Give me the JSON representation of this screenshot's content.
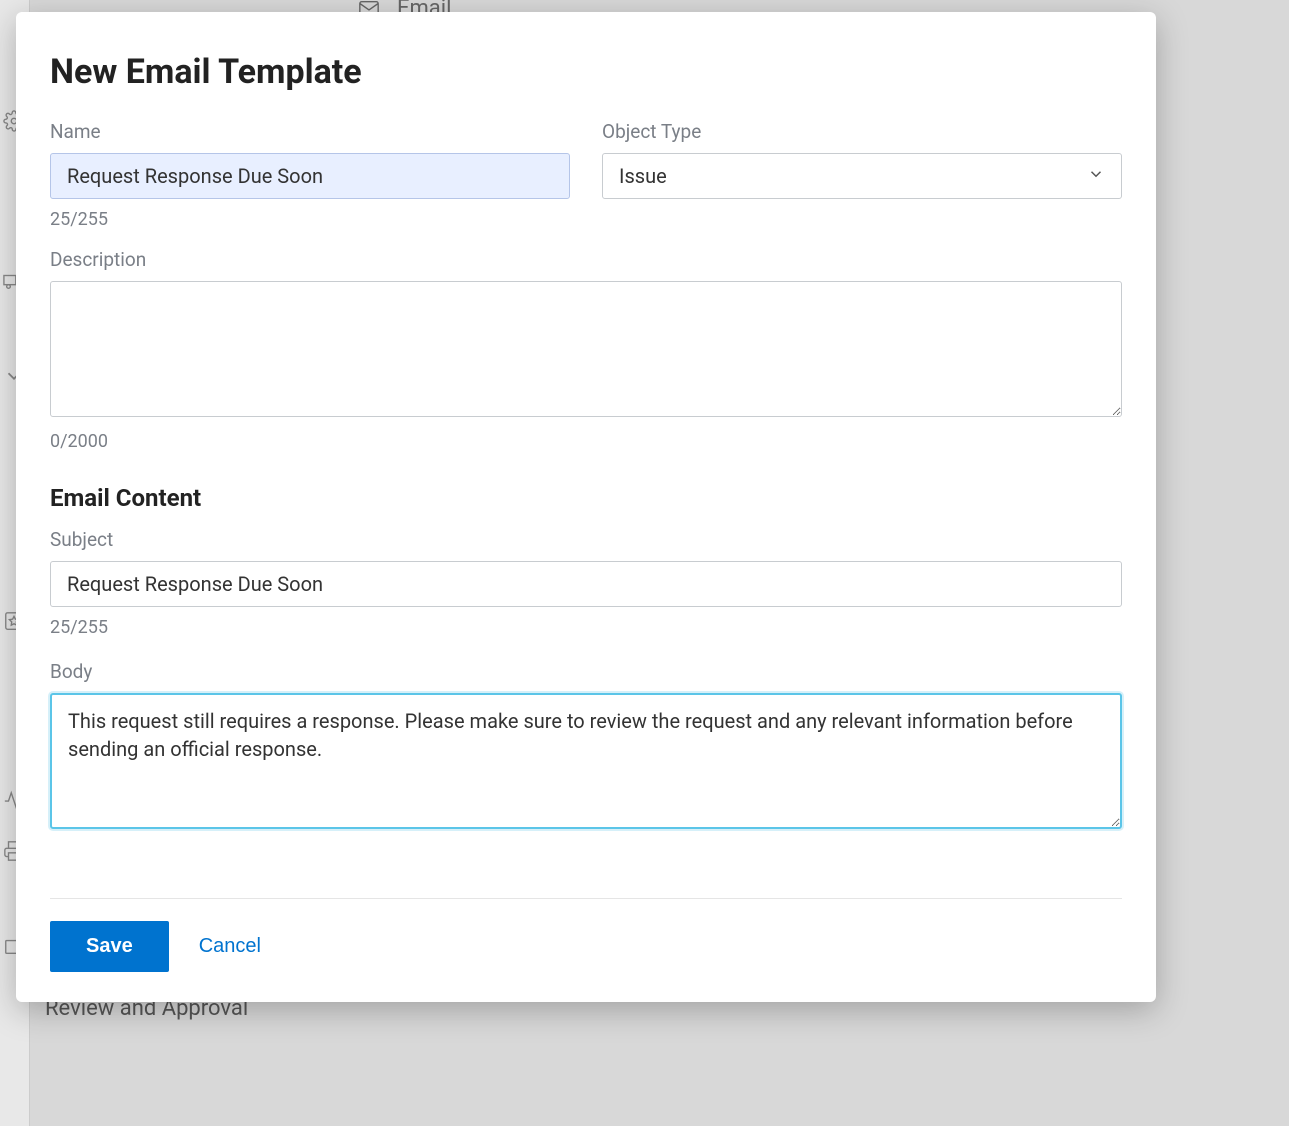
{
  "background": {
    "email_label": "Email",
    "sidebar_item": "Review and Approval"
  },
  "modal": {
    "title": "New Email Template",
    "name": {
      "label": "Name",
      "value": "Request Response Due Soon",
      "counter": "25/255"
    },
    "object_type": {
      "label": "Object Type",
      "value": "Issue"
    },
    "description": {
      "label": "Description",
      "value": "",
      "counter": "0/2000"
    },
    "email_content_heading": "Email Content",
    "subject": {
      "label": "Subject",
      "value": "Request Response Due Soon",
      "counter": "25/255"
    },
    "body": {
      "label": "Body",
      "value": "This request still requires a response. Please make sure to review the request and any relevant information before sending an official response. "
    },
    "actions": {
      "save": "Save",
      "cancel": "Cancel"
    }
  }
}
